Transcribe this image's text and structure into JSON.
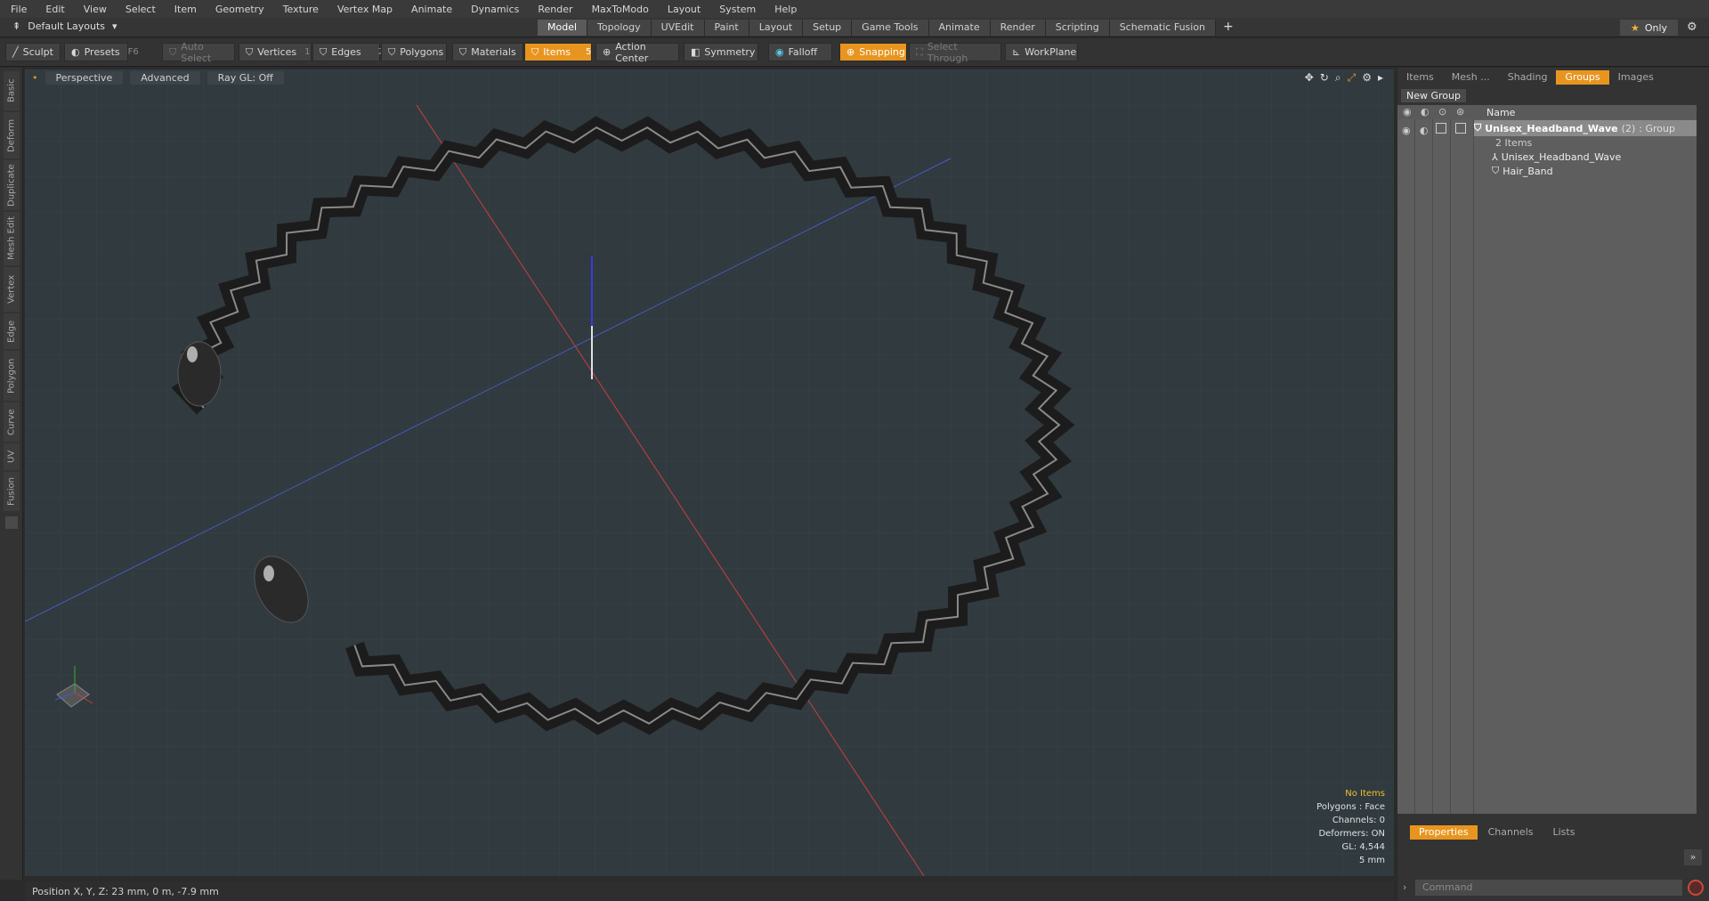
{
  "menu": [
    "File",
    "Edit",
    "View",
    "Select",
    "Item",
    "Geometry",
    "Texture",
    "Vertex Map",
    "Animate",
    "Dynamics",
    "Render",
    "MaxToModo",
    "Layout",
    "System",
    "Help"
  ],
  "layout_dropdown": "Default Layouts",
  "layout_tabs": [
    {
      "label": "Model",
      "active": true
    },
    {
      "label": "Topology"
    },
    {
      "label": "UVEdit"
    },
    {
      "label": "Paint"
    },
    {
      "label": "Layout"
    },
    {
      "label": "Setup"
    },
    {
      "label": "Game Tools"
    },
    {
      "label": "Animate"
    },
    {
      "label": "Render"
    },
    {
      "label": "Scripting"
    },
    {
      "label": "Schematic Fusion"
    }
  ],
  "only_label": "Only",
  "toolbar": {
    "sculpt": "Sculpt",
    "presets": "Presets",
    "presets_key": "F6",
    "auto_select": "Auto Select",
    "vertices": "Vertices",
    "vertices_key": "1",
    "edges": "Edges",
    "edges_key": "2",
    "polygons": "Polygons",
    "materials": "Materials",
    "items": "Items",
    "items_key": "5",
    "action_center": "Action Center",
    "symmetry": "Symmetry",
    "falloff": "Falloff",
    "snapping": "Snapping",
    "select_through": "Select Through",
    "workplane": "WorkPlane"
  },
  "left_tabs": [
    "Basic",
    "Deform",
    "Duplicate",
    "Mesh Edit",
    "Vertex",
    "Edge",
    "Polygon",
    "Curve",
    "UV",
    "Fusion"
  ],
  "viewport": {
    "view_mode": "Perspective",
    "shading": "Advanced",
    "raygl": "Ray GL: Off",
    "info": {
      "items": "No Items",
      "polygons": "Polygons : Face",
      "channels": "Channels: 0",
      "deformers": "Deformers: ON",
      "gl": "GL: 4,544",
      "scale": "5 mm"
    }
  },
  "status": "Position X, Y, Z:  23 mm, 0 m, -7.9 mm",
  "right_panel": {
    "tabs": [
      {
        "label": "Items"
      },
      {
        "label": "Mesh ..."
      },
      {
        "label": "Shading"
      },
      {
        "label": "Groups",
        "active": true
      },
      {
        "label": "Images"
      }
    ],
    "new_group": "New Group",
    "name_header": "Name",
    "group": {
      "name": "Unisex_Headband_Wave",
      "count": "(2)",
      "type": ": Group",
      "items": "2 Items"
    },
    "children": [
      "Unisex_Headband_Wave",
      "Hair_Band"
    ],
    "bottom_tabs": [
      {
        "label": "Properties",
        "active": true
      },
      {
        "label": "Channels"
      },
      {
        "label": "Lists"
      }
    ],
    "command_placeholder": "Command"
  }
}
